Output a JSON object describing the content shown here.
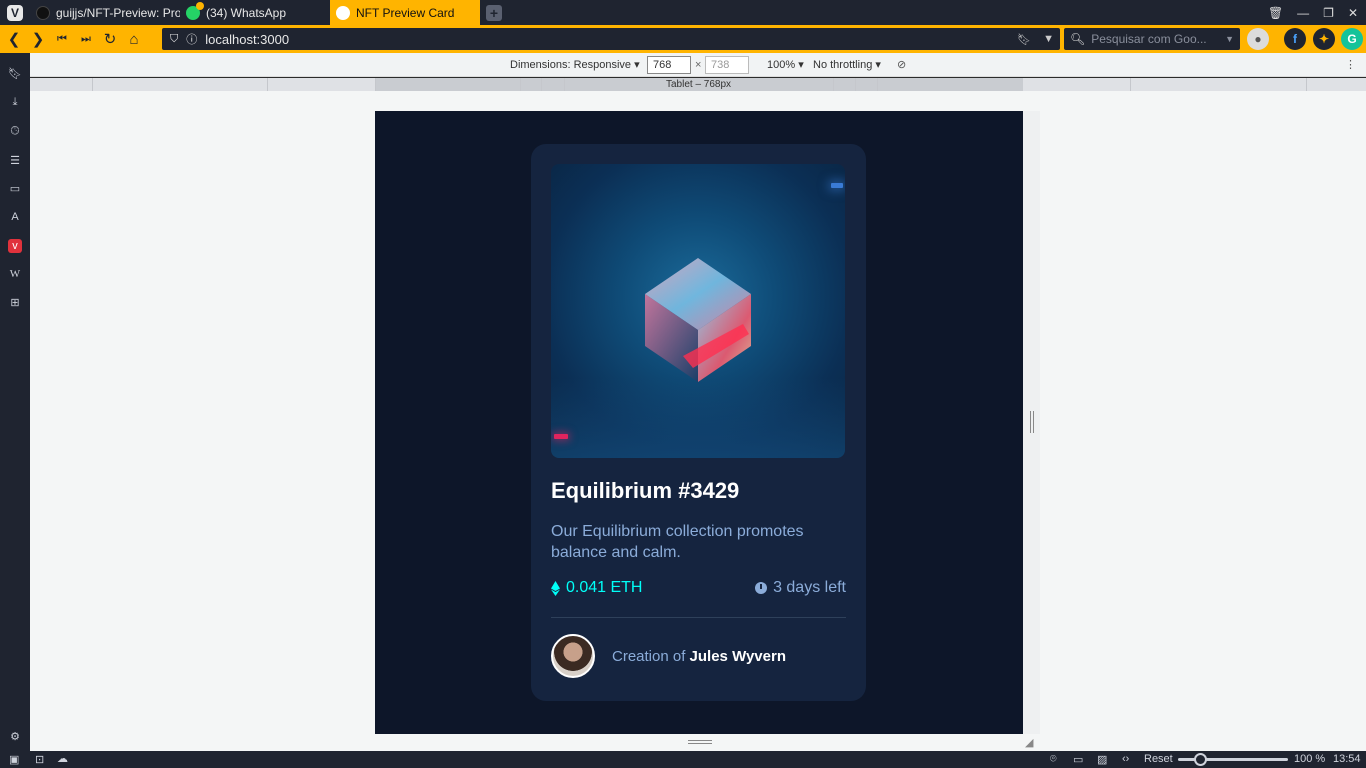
{
  "tabs": [
    {
      "title": "guijjs/NFT-Preview: Proj",
      "icon": "github-icon"
    },
    {
      "title": "(34) WhatsApp",
      "icon": "whatsapp-icon"
    },
    {
      "title": "NFT Preview Card",
      "icon": "nft-icon"
    }
  ],
  "address": {
    "url": "localhost:3000"
  },
  "search": {
    "placeholder": "Pesquisar com Goo..."
  },
  "devtools": {
    "dimensions_label": "Dimensions: Responsive",
    "width": "768",
    "times": "×",
    "height_placeholder": "738",
    "zoom": "100%",
    "throttling": "No throttling",
    "media_label": "Tablet – 768px"
  },
  "card": {
    "title": "Equilibrium #3429",
    "description": "Our Equilibrium collection promotes balance and calm.",
    "price": "0.041 ETH",
    "time_left": "3 days left",
    "creator_prefix": "Creation of ",
    "creator_name": "Jules Wyvern"
  },
  "statusbar": {
    "reset_label": "Reset",
    "zoom_percent": "100 %",
    "zoom_level": 1.0,
    "clock": "13:54"
  },
  "colors": {
    "browser_accent": "#ffb400",
    "page_bg": "#0d1629",
    "card_bg": "#15243f",
    "cyan": "#00fff8",
    "soft_blue": "#8bacd9"
  }
}
